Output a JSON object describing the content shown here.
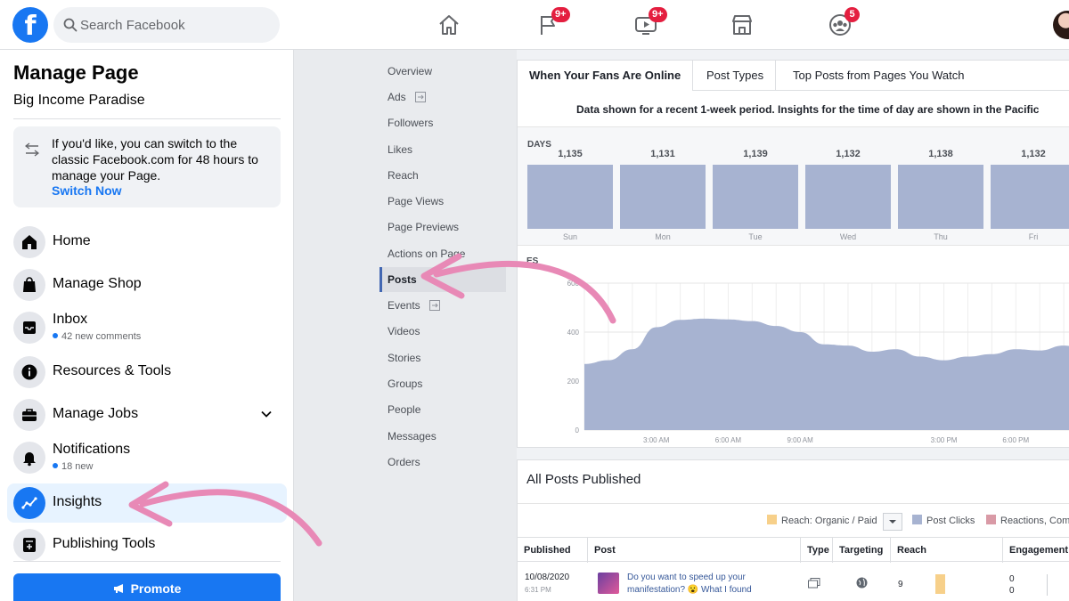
{
  "topbar": {
    "logo_letter": "f",
    "search_placeholder": "Search Facebook",
    "badges": {
      "pages": "9+",
      "watch": "9+",
      "groups": "5"
    }
  },
  "sidebar": {
    "title": "Manage Page",
    "page_name": "Big Income Paradise",
    "notice": {
      "text": "If you'd like, you can switch to the classic Facebook.com for 48 hours to manage your Page.",
      "link": "Switch Now"
    },
    "items": [
      {
        "label": "Home",
        "icon": "home-icon"
      },
      {
        "label": "Manage Shop",
        "icon": "shopping-bag-icon"
      },
      {
        "label": "Inbox",
        "icon": "inbox-icon",
        "sub": "42 new comments"
      },
      {
        "label": "Resources & Tools",
        "icon": "info-icon"
      },
      {
        "label": "Manage Jobs",
        "icon": "briefcase-icon"
      },
      {
        "label": "Notifications",
        "icon": "bell-icon",
        "sub": "18 new"
      },
      {
        "label": "Insights",
        "icon": "insights-icon",
        "active": true
      },
      {
        "label": "Publishing Tools",
        "icon": "publishing-icon"
      }
    ],
    "promote_label": "Promote"
  },
  "insights_nav": [
    "Overview",
    "Ads",
    "Followers",
    "Likes",
    "Reach",
    "Page Views",
    "Page Previews",
    "Actions on Page",
    "Posts",
    "Events",
    "Videos",
    "Stories",
    "Groups",
    "People",
    "Messages",
    "Orders"
  ],
  "insights_nav_active": "Posts",
  "tabs": [
    "When Your Fans Are Online",
    "Post Types",
    "Top Posts from Pages You Watch"
  ],
  "note": "Data shown for a recent 1-week period. Insights for the time of day are shown in the Pacific",
  "days_label": "DAYS",
  "times_label_partial": "ES",
  "chart_data": [
    {
      "type": "bar",
      "categories": [
        "Sun",
        "Mon",
        "Tue",
        "Wed",
        "Thu",
        "Fri"
      ],
      "values": [
        1135,
        1131,
        1139,
        1132,
        1138,
        1132
      ],
      "value_labels": [
        "1,135",
        "1,131",
        "1,139",
        "1,132",
        "1,138",
        "1,132"
      ]
    },
    {
      "type": "area",
      "x_hours": [
        0,
        1,
        2,
        3,
        4,
        5,
        6,
        7,
        8,
        9,
        10,
        11,
        12,
        13,
        14,
        15,
        16,
        17,
        18,
        19,
        20,
        21
      ],
      "values": [
        270,
        285,
        330,
        420,
        450,
        455,
        452,
        445,
        425,
        400,
        350,
        345,
        320,
        330,
        300,
        285,
        300,
        310,
        330,
        325,
        345,
        330
      ],
      "ylim": [
        0,
        600
      ],
      "yticks": [
        "0",
        "200",
        "400",
        "600"
      ],
      "xticks": [
        {
          "hour": 3,
          "label": "3:00 AM"
        },
        {
          "hour": 6,
          "label": "6:00 AM"
        },
        {
          "hour": 9,
          "label": "9:00 AM"
        },
        {
          "hour": 15,
          "label": "3:00 PM"
        },
        {
          "hour": 18,
          "label": "6:00 PM"
        },
        {
          "hour": 21,
          "label": "9:00 PM"
        }
      ],
      "color": "#a7b3d1"
    }
  ],
  "posts": {
    "title": "All Posts Published",
    "legend": [
      {
        "label": "Reach: Organic / Paid",
        "color": "#f7d08a"
      },
      {
        "label": "Post Clicks",
        "color": "#a7b3d1"
      },
      {
        "label": "Reactions, Com",
        "color": "#d99aa6"
      }
    ],
    "columns": [
      "Published",
      "Post",
      "Type",
      "Targeting",
      "Reach",
      "Engagement"
    ],
    "rows": [
      {
        "date": "10/08/2020",
        "time": "6:31 PM",
        "post_line1": "Do you want to speed up your",
        "post_line2": "manifestation? 😮 What I found",
        "reach": "9",
        "eng1": "0",
        "eng2": "0"
      }
    ]
  },
  "colors": {
    "brand": "#1877f2",
    "badge": "#e41e3f",
    "bar": "#a7b3d1",
    "arrow": "#e889b6"
  }
}
